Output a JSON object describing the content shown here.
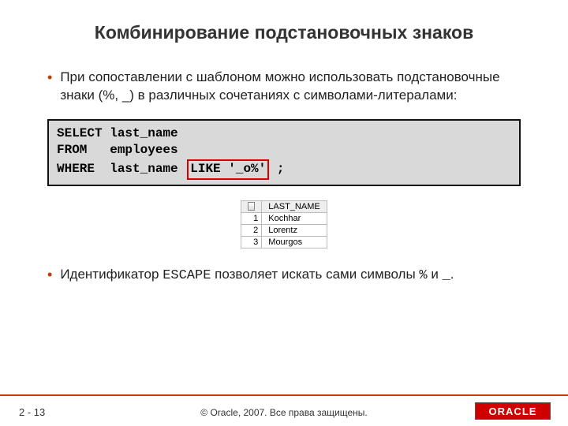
{
  "title": "Комбинирование подстановочных знаков",
  "bullets": {
    "b1": "При сопоставлении с шаблоном можно использовать подстановочные знаки (%, _) в различных сочетаниях с символами-литералами:",
    "b2_pre": "Идентификатор ",
    "b2_code": "ESCAPE",
    "b2_mid": " позволяет искать сами символы ",
    "b2_pct": "%",
    "b2_and": " и ",
    "b2_us": "_",
    "b2_end": "."
  },
  "code": {
    "l1": "SELECT last_name",
    "l2": "FROM   employees",
    "l3a": "WHERE  last_name ",
    "l3b": "LIKE '_o%'",
    "l3c": " ;"
  },
  "result": {
    "header": "LAST_NAME",
    "rows": [
      {
        "n": "1",
        "v": "Kochhar"
      },
      {
        "n": "2",
        "v": "Lorentz"
      },
      {
        "n": "3",
        "v": "Mourgos"
      }
    ]
  },
  "footer": {
    "page": "2 - 13",
    "copyright": "© Oracle, 2007. Все права защищены.",
    "logo": "ORACLE"
  }
}
